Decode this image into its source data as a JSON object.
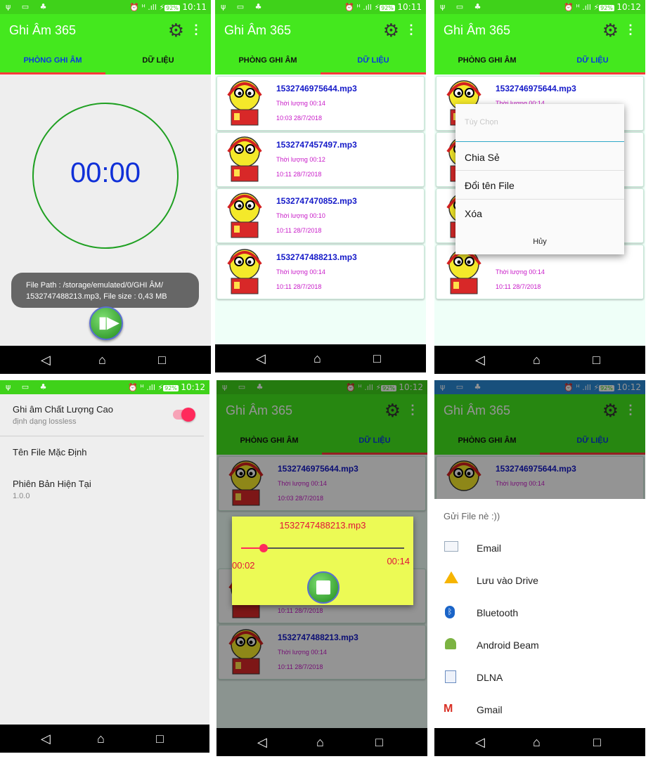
{
  "status": {
    "s1_time": "10:11",
    "s2_time": "10:11",
    "s3_time": "10:12",
    "s4_time": "10:12",
    "s5_time": "10:12",
    "s6_time": "10:12",
    "battery": "92%"
  },
  "app": {
    "title": "Ghi Âm 365",
    "tab_record": "PHÒNG GHI ÂM",
    "tab_data": "DỮ LIỆU"
  },
  "record": {
    "timer": "00:00",
    "toast_line1": "File Path : /storage/emulated/0/GHI ÂM/",
    "toast_line2": "1532747488213.mp3, File size : 0,43 MB"
  },
  "recordings": [
    {
      "name": "1532746975644.mp3",
      "duration": "Thời lượng 00:14",
      "date": "10:03 28/7/2018"
    },
    {
      "name": "1532747457497.mp3",
      "duration": "Thời lượng 00:12",
      "date": "10:11 28/7/2018"
    },
    {
      "name": "1532747470852.mp3",
      "duration": "Thời lượng 00:10",
      "date": "10:11 28/7/2018"
    },
    {
      "name": "1532747488213.mp3",
      "duration": "Thời lượng 00:14",
      "date": "10:11 28/7/2018"
    }
  ],
  "options_dialog": {
    "title": "Tùy Chọn",
    "share": "Chia Sẻ",
    "rename": "Đổi tên File",
    "delete": "Xóa",
    "cancel": "Hủy"
  },
  "settings": {
    "hq_title": "Ghi âm Chất Lượng Cao",
    "hq_sub": "định dạng lossless",
    "hq_enabled": true,
    "default_name": "Tên File Mặc Định",
    "version_title": "Phiên Bản Hiện Tại",
    "version": "1.0.0"
  },
  "player": {
    "file": "1532747488213.mp3",
    "elapsed": "00:02",
    "total": "00:14",
    "progress": 0.14
  },
  "share_sheet": {
    "title": "Gửi File nè :))",
    "items": [
      {
        "label": "Email",
        "icon": "email-icon"
      },
      {
        "label": "Lưu vào Drive",
        "icon": "drive-icon"
      },
      {
        "label": "Bluetooth",
        "icon": "bluetooth-icon"
      },
      {
        "label": "Android Beam",
        "icon": "android-icon"
      },
      {
        "label": "DLNA",
        "icon": "dlna-icon"
      },
      {
        "label": "Gmail",
        "icon": "gmail-icon"
      }
    ]
  },
  "colors": {
    "status_bar": "#3fd21a",
    "app_bar": "#44e81e",
    "tab_active_text": "#0a39e0",
    "tab_indicator": "#ff3a3a",
    "file_name": "#1419c8",
    "meta_text": "#c81ac8",
    "timer_circle": "#1fa022",
    "timer_text": "#1030d8",
    "toggle_on": "#ff2a5c",
    "player_bg": "#ecfa55"
  }
}
